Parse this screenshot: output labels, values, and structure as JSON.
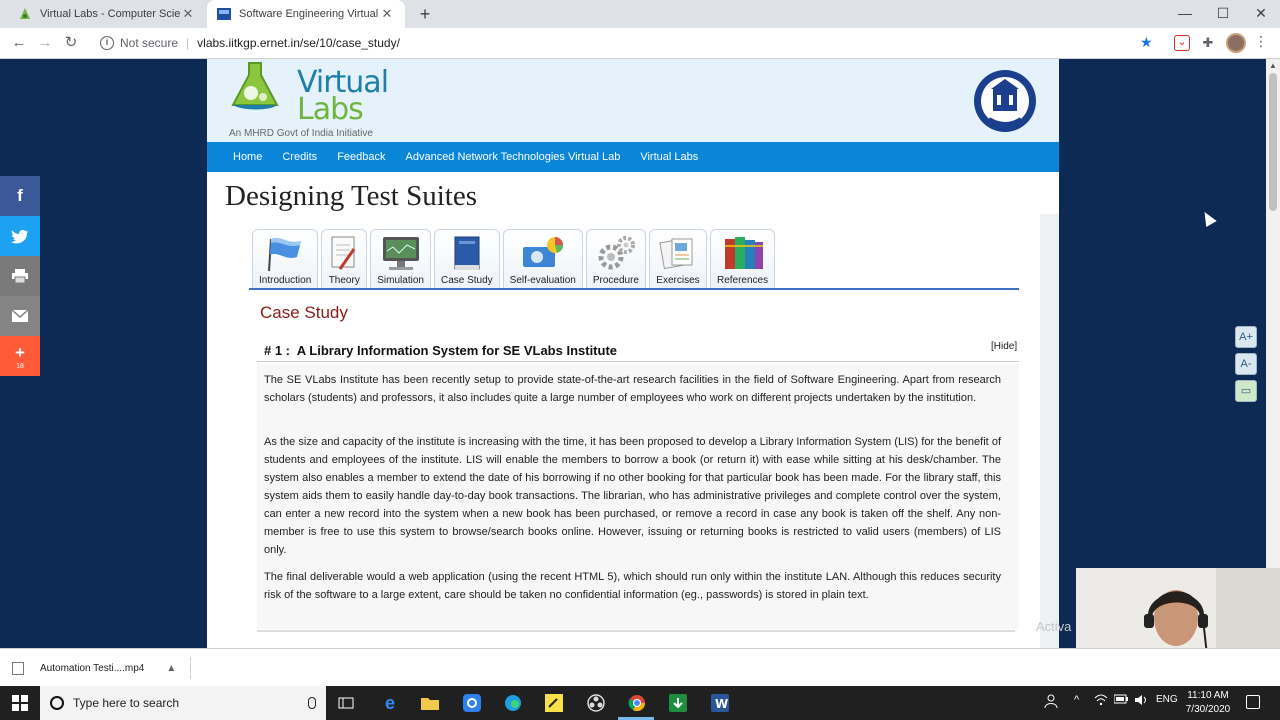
{
  "browser": {
    "tabs": [
      {
        "title": "Virtual Labs - Computer Science"
      },
      {
        "title": "Software Engineering Virtual Lab"
      }
    ],
    "new_tab": "+",
    "address": {
      "security": "Not secure",
      "url": "vlabs.iitkgp.ernet.in/se/10/case_study/"
    }
  },
  "site": {
    "logo_line1": "Virtual",
    "logo_line2": "Labs",
    "logo_tagline": "An MHRD Govt of India Initiative",
    "nav": [
      "Home",
      "Credits",
      "Feedback",
      "Advanced Network Technologies Virtual Lab",
      "Virtual Labs"
    ],
    "page_title": "Designing Test Suites",
    "lab_tabs": [
      {
        "label": "Introduction",
        "icon": "flag-icon"
      },
      {
        "label": "Theory",
        "icon": "notepad-icon"
      },
      {
        "label": "Simulation",
        "icon": "monitor-icon"
      },
      {
        "label": "Case Study",
        "icon": "book-icon"
      },
      {
        "label": "Self-evaluation",
        "icon": "globe-chart-icon"
      },
      {
        "label": "Procedure",
        "icon": "gears-icon"
      },
      {
        "label": "Exercises",
        "icon": "documents-icon"
      },
      {
        "label": "References",
        "icon": "books-icon"
      }
    ],
    "section_heading": "Case Study",
    "case": {
      "number": "# 1 :",
      "title": "A Library Information System for SE VLabs Institute",
      "hide_label": "[Hide]",
      "paragraphs": [
        "The SE VLabs Institute has been recently setup to provide state-of-the-art research facilities in the field of Software Engineering. Apart from research scholars (students) and professors, it also includes quite a large number of employees who work on different projects undertaken by the institution.",
        "As the size and capacity of the institute is increasing with the time, it has been proposed to develop a Library Information System (LIS) for the benefit of students and employees of the institute. LIS will enable the members to borrow a book (or return it) with ease while sitting at his desk/chamber. The system also enables a member to extend the date of his borrowing if no other booking for that particular book has been made. For the library staff, this system aids them to easily handle day-to-day book transactions. The librarian, who has administrative privileges and complete control over the system, can enter a new record into the system when a new book has been purchased, or remove a record in case any book is taken off the shelf. Any non-member is free to use this system to browse/search books online. However, issuing or returning books is restricted to valid users (members) of LIS only.",
        "The final deliverable would a web application (using the recent HTML 5), which should run only within the institute LAN. Although this reduces security risk of the software to a large extent, care should be taken no confidential information (eg., passwords) is stored in plain text."
      ]
    },
    "watermark": "Activa"
  },
  "share": {
    "plus_count": "18"
  },
  "downloads": {
    "file": "Automation Testi....mp4"
  },
  "taskbar": {
    "search_placeholder": "Type here to search",
    "language": "ENG",
    "time": "11:10 AM",
    "date": "7/30/2020"
  },
  "colors": {
    "nav_blue": "#0a86d8",
    "page_bg": "#0c2a54",
    "section_red": "#8b1a1a"
  }
}
